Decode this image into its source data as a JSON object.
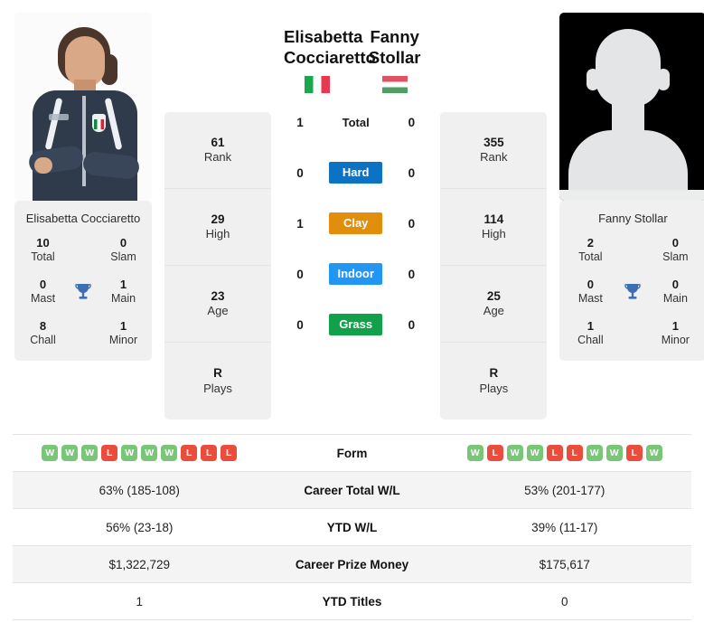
{
  "colors": {
    "hard": "#0b72c4",
    "clay": "#e08e0b",
    "indoor": "#2196f3",
    "grass": "#13a04b",
    "win": "#79c679",
    "loss": "#eb4d3d",
    "trophy": "#3c6eb4"
  },
  "player_left": {
    "first_name": "Elisabetta",
    "last_name": "Cocciaretto",
    "full_name": "Elisabetta Cocciaretto",
    "photo_caption": "Elisabetta Cocciaretto",
    "country": "Italy",
    "flag": "flag-italy",
    "titles": {
      "total_value": "10",
      "total_label": "Total",
      "slam_value": "0",
      "slam_label": "Slam",
      "mast_value": "0",
      "mast_label": "Mast",
      "main_value": "1",
      "main_label": "Main",
      "chall_value": "8",
      "chall_label": "Chall",
      "minor_value": "1",
      "minor_label": "Minor"
    },
    "stats": [
      {
        "value": "61",
        "label": "Rank"
      },
      {
        "value": "29",
        "label": "High"
      },
      {
        "value": "23",
        "label": "Age"
      },
      {
        "value": "R",
        "label": "Plays"
      }
    ],
    "form": [
      "W",
      "W",
      "W",
      "L",
      "W",
      "W",
      "W",
      "L",
      "L",
      "L"
    ],
    "career_total_wl": "63% (185-108)",
    "ytd_wl": "56% (23-18)",
    "career_prize_money": "$1,322,729",
    "ytd_titles": "1"
  },
  "player_right": {
    "first_name": "Fanny",
    "last_name": "Stollar",
    "full_name": "Fanny Stollar",
    "photo_caption": "Fanny Stollar",
    "country": "Hungary",
    "flag": "flag-hungary",
    "titles": {
      "total_value": "2",
      "total_label": "Total",
      "slam_value": "0",
      "slam_label": "Slam",
      "mast_value": "0",
      "mast_label": "Mast",
      "main_value": "0",
      "main_label": "Main",
      "chall_value": "1",
      "chall_label": "Chall",
      "minor_value": "1",
      "minor_label": "Minor"
    },
    "stats": [
      {
        "value": "355",
        "label": "Rank"
      },
      {
        "value": "114",
        "label": "High"
      },
      {
        "value": "25",
        "label": "Age"
      },
      {
        "value": "R",
        "label": "Plays"
      }
    ],
    "form": [
      "W",
      "L",
      "W",
      "W",
      "L",
      "L",
      "W",
      "W",
      "L",
      "W"
    ],
    "career_total_wl": "53% (201-177)",
    "ytd_wl": "39% (11-17)",
    "career_prize_money": "$175,617",
    "ytd_titles": "0"
  },
  "head_to_head": [
    {
      "label": "Total",
      "left": "1",
      "right": "0",
      "style": "plain"
    },
    {
      "label": "Hard",
      "left": "0",
      "right": "0",
      "style": "hard"
    },
    {
      "label": "Clay",
      "left": "1",
      "right": "0",
      "style": "clay"
    },
    {
      "label": "Indoor",
      "left": "0",
      "right": "0",
      "style": "indoor"
    },
    {
      "label": "Grass",
      "left": "0",
      "right": "0",
      "style": "grass"
    }
  ],
  "comparison_rows": [
    {
      "label": "Form",
      "type": "form"
    },
    {
      "label": "Career Total W/L",
      "type": "text",
      "left": "63% (185-108)",
      "right": "53% (201-177)"
    },
    {
      "label": "YTD W/L",
      "type": "text",
      "left": "56% (23-18)",
      "right": "39% (11-17)"
    },
    {
      "label": "Career Prize Money",
      "type": "text",
      "left": "$1,322,729",
      "right": "$175,617"
    },
    {
      "label": "YTD Titles",
      "type": "text",
      "left": "1",
      "right": "0"
    }
  ]
}
